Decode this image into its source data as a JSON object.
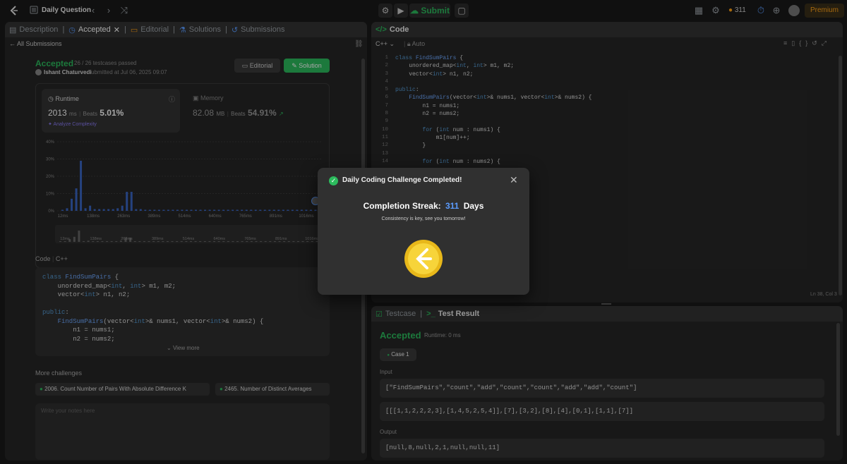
{
  "topbar": {
    "title": "Daily Question",
    "submit_label": "Submit",
    "streak_count": "311",
    "premium_label": "Premium"
  },
  "left": {
    "tabs": [
      "Description",
      "Accepted",
      "Editorial",
      "Solutions",
      "Submissions"
    ],
    "back_label": "All Submissions",
    "status": "Accepted",
    "testcases": "26 / 26 testcases passed",
    "user": "Ishant Chaturvedi",
    "submitted_text": "submitted at Jul 06, 2025 09:07",
    "editorial_btn": "Editorial",
    "solution_btn": "Solution",
    "runtime": {
      "label": "Runtime",
      "value": "2013",
      "unit": "ms",
      "beats_label": "Beats",
      "beats": "5.01%",
      "analyze": "Analyze Complexity"
    },
    "memory": {
      "label": "Memory",
      "value": "82.08",
      "unit": "MB",
      "beats_label": "Beats",
      "beats": "54.91%"
    },
    "code_header": "Code",
    "code_lang": "C++",
    "code_lines": [
      "class FindSumPairs {",
      "    unordered_map<int, int> m1, m2;",
      "    vector<int> n1, n2;",
      "",
      "public:",
      "    FindSumPairs(vector<int>& nums1, vector<int>& nums2) {",
      "        n1 = nums1;",
      "        n2 = nums2;"
    ],
    "view_more": "View more",
    "more_challenges": "More challenges",
    "challenge1": "2006. Count Number of Pairs With Absolute Difference K",
    "challenge2": "2465. Number of Distinct Averages",
    "notes_placeholder": "Write your notes here"
  },
  "chart_data": {
    "type": "bar",
    "yticks": [
      "40%",
      "30%",
      "20%",
      "10%",
      "0%"
    ],
    "xticks": [
      "12ms",
      "138ms",
      "263ms",
      "389ms",
      "514ms",
      "640ms",
      "765ms",
      "891ms",
      "1016ms"
    ],
    "ylim": [
      0,
      40
    ],
    "values": [
      0.5,
      1.5,
      7,
      13,
      29,
      1.5,
      3,
      1,
      1,
      1,
      1,
      1,
      1.5,
      3,
      11,
      11,
      1,
      1,
      0.5,
      0.5,
      0.5,
      0.5,
      0.5,
      0.5,
      0.5,
      0.5,
      0.5,
      0.5,
      0.5,
      0.5,
      0.5,
      0.5,
      0.5,
      0.5,
      0.5,
      0.5,
      0.5,
      0.5,
      0.5,
      0.5,
      0.5,
      0.5,
      0.5,
      0.5,
      0.5,
      0.5,
      0.5,
      0.5,
      0.5,
      0.5,
      0.5,
      0.5,
      0.5,
      0.5,
      0.5,
      0.5
    ]
  },
  "editor": {
    "header": "Code",
    "lang": "C++",
    "mode": "Auto",
    "lines": [
      "class FindSumPairs {",
      "    unordered_map<int, int> m1, m2;",
      "    vector<int> n1, n2;",
      "",
      "public:",
      "    FindSumPairs(vector<int>& nums1, vector<int>& nums2) {",
      "        n1 = nums1;",
      "        n2 = nums2;",
      "",
      "        for (int num : nums1) {",
      "            m1[num]++;",
      "        }",
      "",
      "        for (int num : nums2) {"
    ],
    "line_numbers": [
      "1",
      "2",
      "3",
      "4",
      "5",
      "6",
      "7",
      "8",
      "9",
      "10",
      "11",
      "12",
      "13",
      "14"
    ],
    "cursor": "Ln 38, Col 3"
  },
  "result": {
    "tab_testcase": "Testcase",
    "tab_result": "Test Result",
    "status": "Accepted",
    "runtime": "Runtime: 0 ms",
    "case": "Case 1",
    "input_label": "Input",
    "input1": "[\"FindSumPairs\",\"count\",\"add\",\"count\",\"count\",\"add\",\"add\",\"count\"]",
    "input2": "[[[1,1,2,2,2,3],[1,4,5,2,5,4]],[7],[3,2],[8],[4],[0,1],[1,1],[7]]",
    "output_label": "Output",
    "output": "[null,8,null,2,1,null,null,11]"
  },
  "modal": {
    "title": "Daily Coding Challenge Completed!",
    "streak_label": "Completion Streak:",
    "streak_value": "311",
    "streak_unit": "Days",
    "message": "Consistency is key, see you tomorrow!"
  }
}
